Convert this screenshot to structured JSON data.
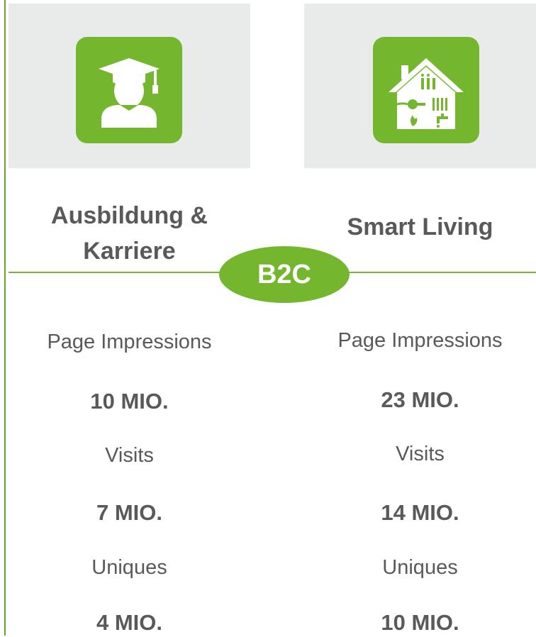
{
  "icons": {
    "left": "graduate-icon",
    "right": "smart-home-icon"
  },
  "colors": {
    "accent": "#74b72e",
    "card_background": "#e8ebea",
    "text": "#595959"
  },
  "badge": "B2C",
  "categories": [
    {
      "title_line1": "Ausbildung &",
      "title_line2": "Karriere",
      "stats": [
        {
          "label": "Page Impressions",
          "value": "10 MIO."
        },
        {
          "label": "Visits",
          "value": "7 MIO."
        },
        {
          "label": "Uniques",
          "value": "4 MIO."
        }
      ]
    },
    {
      "title_line1": "Smart Living",
      "stats": [
        {
          "label": "Page Impressions",
          "value": "23 MIO."
        },
        {
          "label": "Visits",
          "value": "14 MIO."
        },
        {
          "label": "Uniques",
          "value": "10 MIO."
        }
      ]
    }
  ]
}
